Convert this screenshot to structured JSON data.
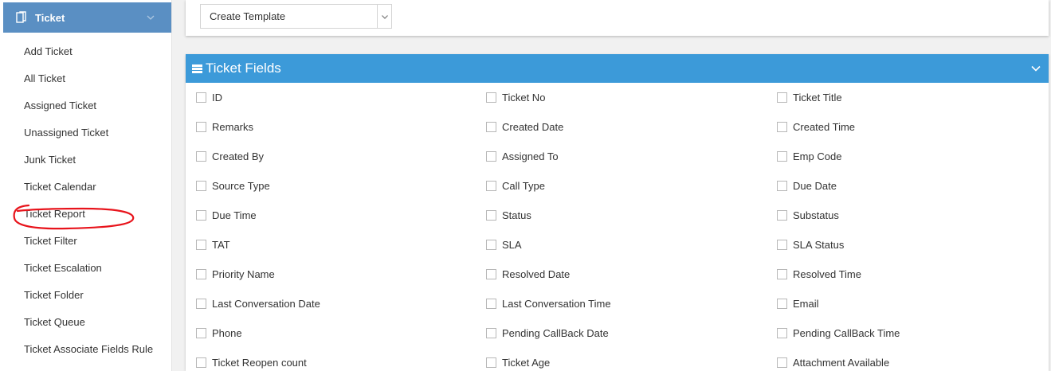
{
  "sidebar": {
    "header": {
      "title": "Ticket"
    },
    "items": [
      {
        "label": "Add Ticket"
      },
      {
        "label": "All Ticket"
      },
      {
        "label": "Assigned Ticket"
      },
      {
        "label": "Unassigned Ticket"
      },
      {
        "label": "Junk Ticket"
      },
      {
        "label": "Ticket Calendar"
      },
      {
        "label": "Ticket Report"
      },
      {
        "label": "Ticket Filter"
      },
      {
        "label": "Ticket Escalation"
      },
      {
        "label": "Ticket Folder"
      },
      {
        "label": "Ticket Queue"
      },
      {
        "label": "Ticket Associate Fields Rule"
      }
    ],
    "highlighted_item": "Ticket Report",
    "annotation_color": "#e8141c"
  },
  "template": {
    "selected": "Create Template"
  },
  "fields_panel": {
    "title": "Ticket Fields",
    "rows": [
      [
        "ID",
        "Ticket No",
        "Ticket Title"
      ],
      [
        "Remarks",
        "Created Date",
        "Created Time"
      ],
      [
        "Created By",
        "Assigned To",
        "Emp Code"
      ],
      [
        "Source Type",
        "Call Type",
        "Due Date"
      ],
      [
        "Due Time",
        "Status",
        "Substatus"
      ],
      [
        "TAT",
        "SLA",
        "SLA Status"
      ],
      [
        "Priority Name",
        "Resolved Date",
        "Resolved Time"
      ],
      [
        "Last Conversation Date",
        "Last Conversation Time",
        "Email"
      ],
      [
        "Phone",
        "Pending CallBack Date",
        "Pending CallBack Time"
      ],
      [
        "Ticket Reopen count",
        "Ticket Age",
        "Attachment Available"
      ]
    ]
  },
  "colors": {
    "sidebar_header": "#5a8fc3",
    "panel_header": "#3c9ad9",
    "background": "#f1f1f1"
  }
}
